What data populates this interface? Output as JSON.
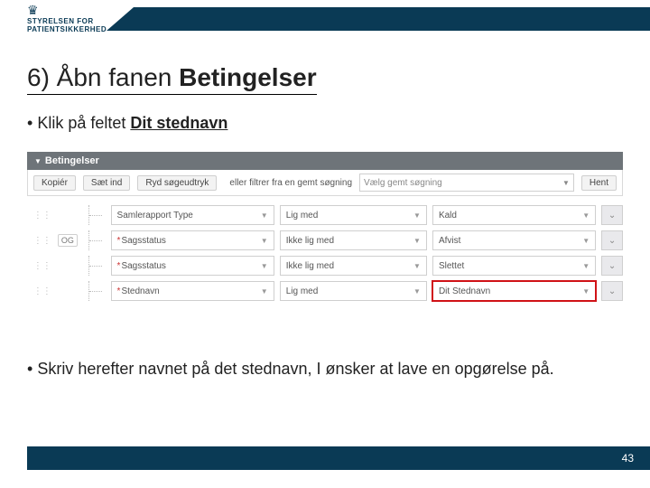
{
  "logo": {
    "line1": "STYRELSEN FOR",
    "line2": "PATIENTSIKKERHED"
  },
  "title": {
    "pre": "6) Åbn fanen ",
    "bold": "Betingelser"
  },
  "bullet1": {
    "pre": "Klik på feltet ",
    "bold": "Dit stednavn"
  },
  "bullet2": "Skriv herefter navnet på det stednavn, I ønsker at lave en opgørelse på.",
  "page": "43",
  "ui": {
    "panelTitle": "Betingelser",
    "toolbar": {
      "copy": "Kopiér",
      "paste": "Sæt ind",
      "clear": "Ryd søgeudtryk",
      "filterLabel": "eller filtrer fra en gemt søgning",
      "selectPlaceholder": "Vælg gemt søgning",
      "fetch": "Hent"
    },
    "andLabel": "OG",
    "rows": [
      {
        "field": "Samlerapport Type",
        "op": "Lig med",
        "val": "Kald",
        "req": false
      },
      {
        "field": "Sagsstatus",
        "op": "Ikke lig med",
        "val": "Afvist",
        "req": true
      },
      {
        "field": "Sagsstatus",
        "op": "Ikke lig med",
        "val": "Slettet",
        "req": true
      },
      {
        "field": "Stednavn",
        "op": "Lig med",
        "val": "Dit Stednavn",
        "req": true
      }
    ]
  }
}
